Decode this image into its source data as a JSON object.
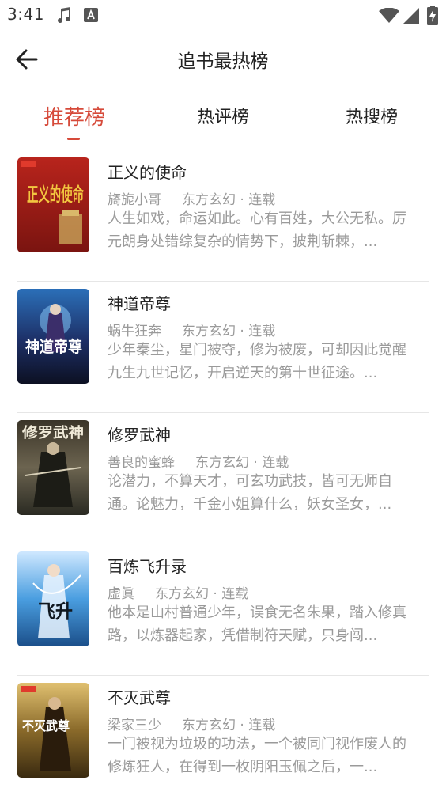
{
  "status_bar": {
    "time": "3:41"
  },
  "header": {
    "title": "追书最热榜"
  },
  "tabs": [
    {
      "label": "推荐榜",
      "active": true
    },
    {
      "label": "热评榜",
      "active": false
    },
    {
      "label": "热搜榜",
      "active": false
    }
  ],
  "books": [
    {
      "title": "正义的使命",
      "author": "旖旎小哥",
      "genre": "东方玄幻 · 连载",
      "description": "人生如戏，命运如此。心有百姓，大公无私。厉元朗身处错综复杂的情势下，披荆斩棘，...",
      "cover_text": "正义的使命"
    },
    {
      "title": "神道帝尊",
      "author": "蜗牛狂奔",
      "genre": "东方玄幻 · 连载",
      "description": "少年秦尘，星门被夺，修为被废，可却因此觉醒九生九世记忆，开启逆天的第十世征途。...",
      "cover_text": "神道帝尊"
    },
    {
      "title": "修罗武神",
      "author": "善良的蜜蜂",
      "genre": "东方玄幻 · 连载",
      "description": "论潜力，不算天才，可玄功武技，皆可无师自通。论魅力，千金小姐算什么，妖女圣女，...",
      "cover_text": "修罗武神"
    },
    {
      "title": "百炼飞升录",
      "author": "虚眞",
      "genre": "东方玄幻 · 连载",
      "description": "他本是山村普通少年，误食无名朱果，踏入修真路，以炼器起家，凭借制符天赋，只身闯...",
      "cover_text": "飞升"
    },
    {
      "title": "不灭武尊",
      "author": "梁家三少",
      "genre": "东方玄幻 · 连载",
      "description": "一门被视为垃圾的功法，一个被同门视作废人的修炼狂人，在得到一枚阴阳玉佩之后，一...",
      "cover_text": "不灭武尊"
    }
  ]
}
